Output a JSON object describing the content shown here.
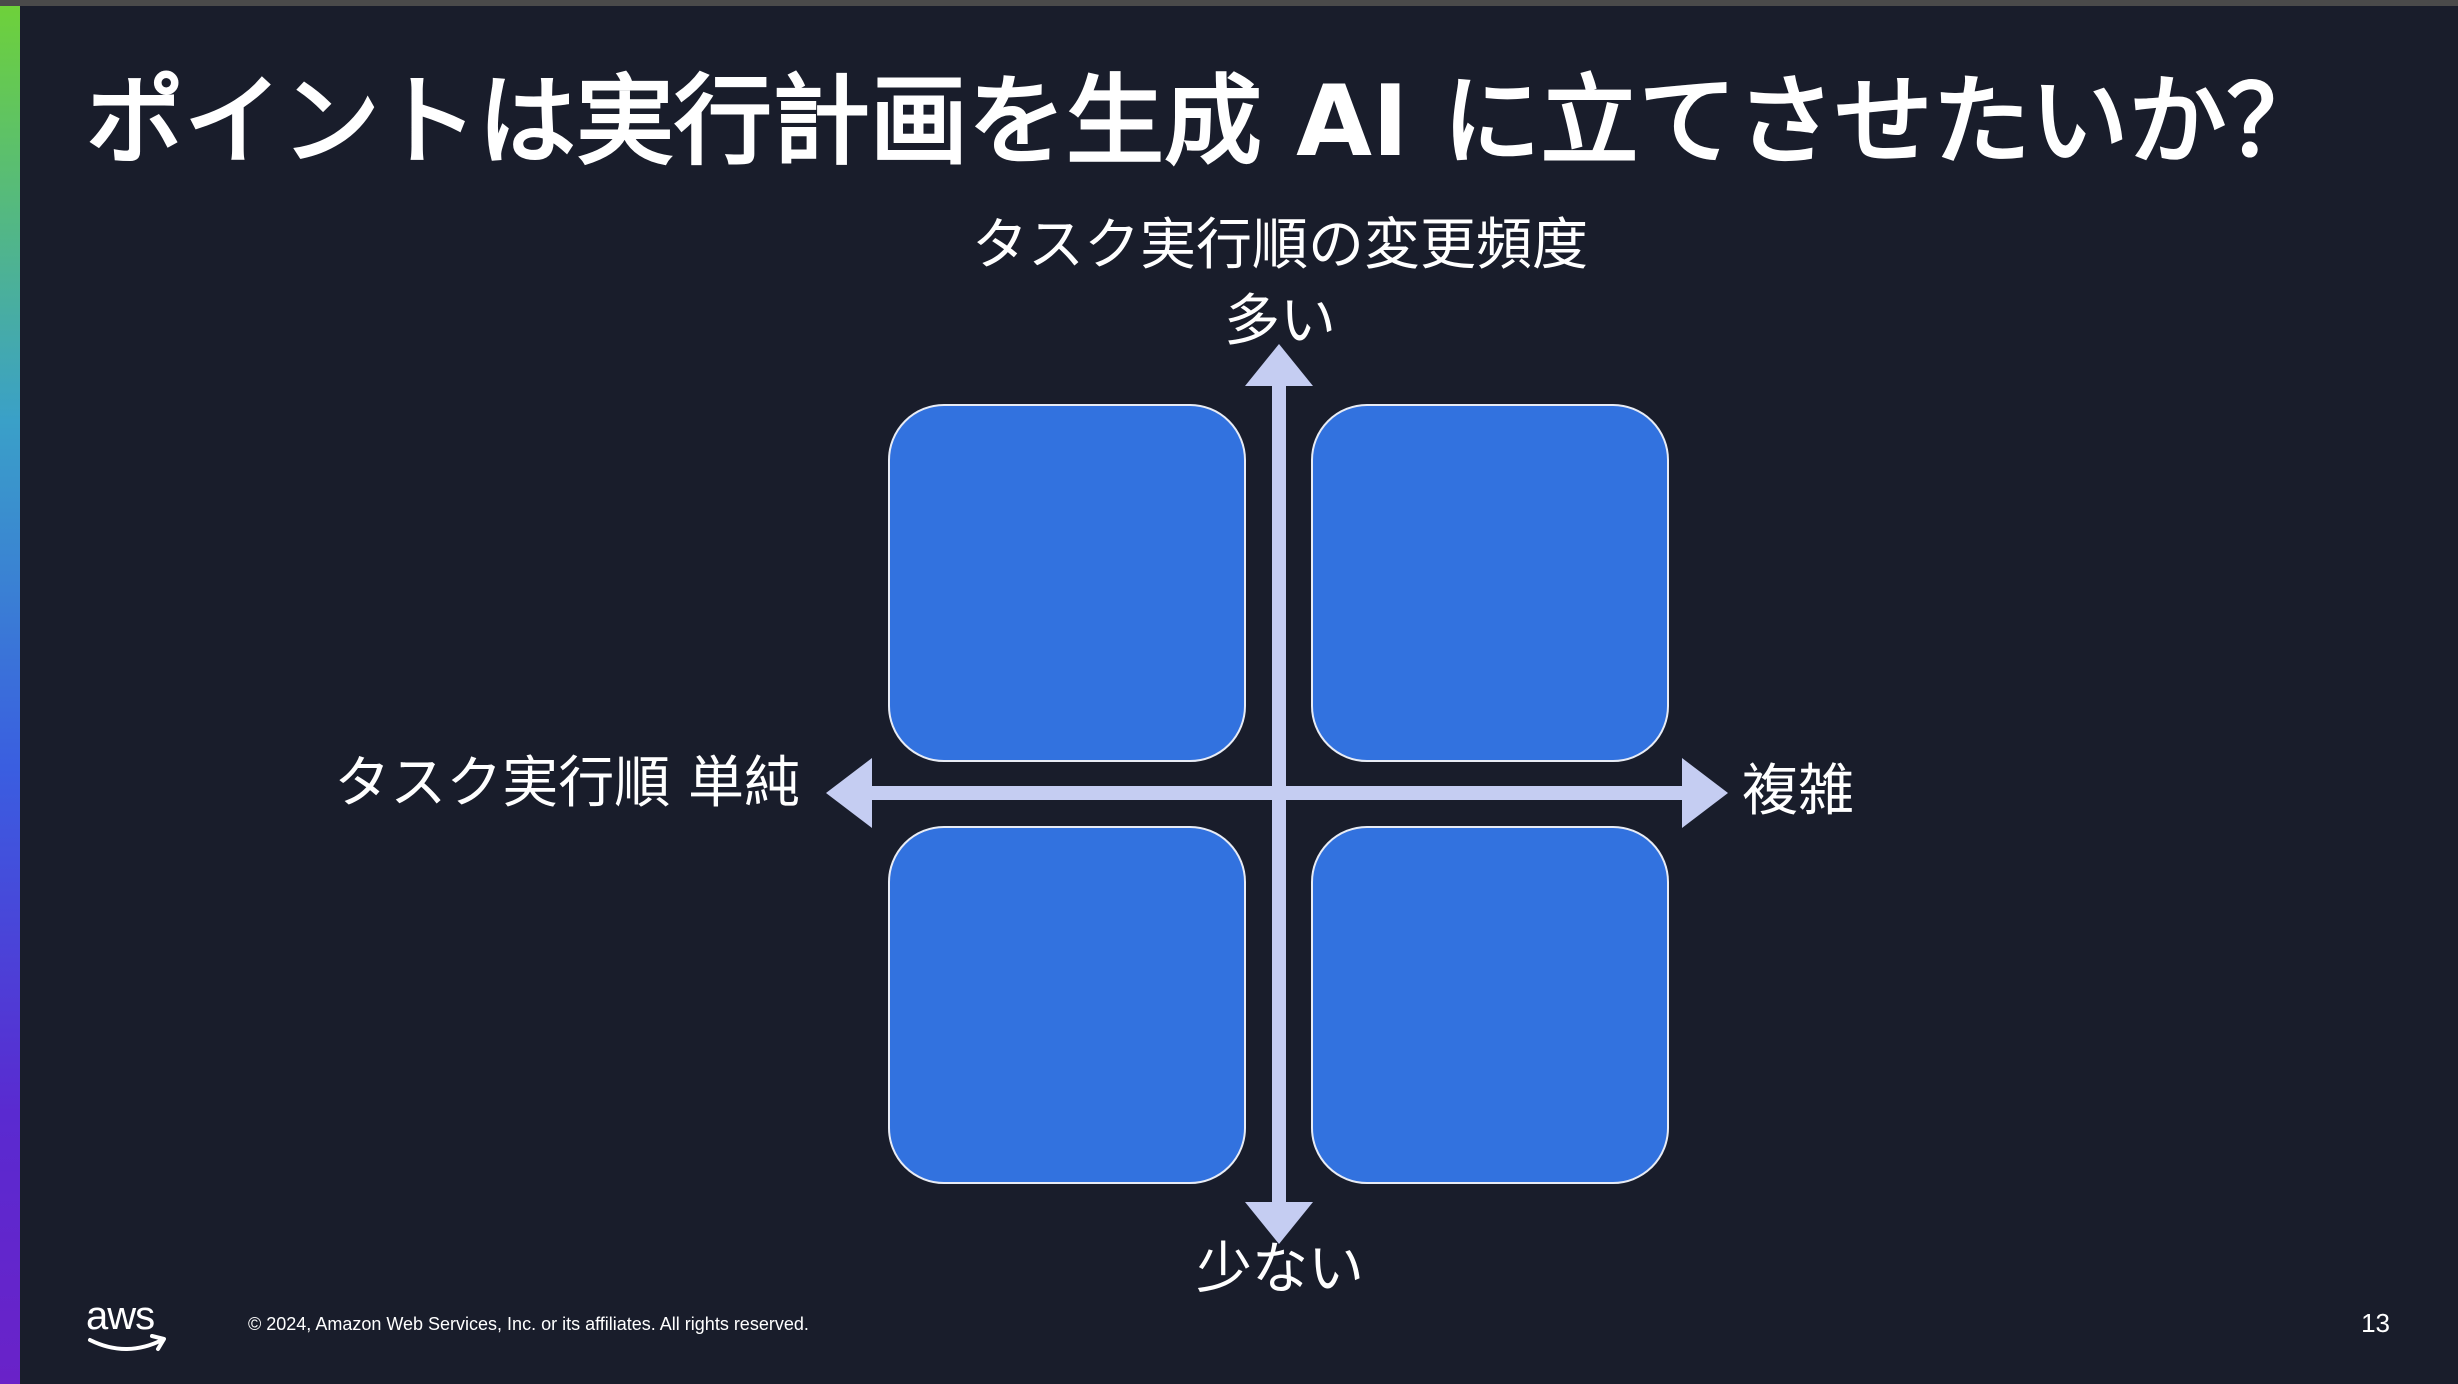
{
  "slide": {
    "title": "ポイントは実行計画を生成 AI に立てさせたいか？",
    "page_number": "13",
    "copyright": "© 2024, Amazon Web Services, Inc. or its affiliates. All rights reserved.",
    "logo_text": "aws"
  },
  "diagram": {
    "vertical_axis": {
      "title": "タスク実行順の変更頻度",
      "high_label": "多い",
      "low_label": "少ない"
    },
    "horizontal_axis": {
      "low_label": "タスク実行順 単純",
      "high_label": "複雑"
    },
    "quadrants": [
      {
        "position": "top-left",
        "label": ""
      },
      {
        "position": "top-right",
        "label": ""
      },
      {
        "position": "bottom-left",
        "label": ""
      },
      {
        "position": "bottom-right",
        "label": ""
      }
    ]
  },
  "colors": {
    "background": "#191d2b",
    "quadrant_fill": "#3272df",
    "quadrant_border": "#e8ecf5",
    "axis": "#c5cdf2",
    "text": "#ffffff",
    "accent_gradient": [
      "#6ed13a",
      "#3aa0c8",
      "#3a5ee0",
      "#6a22c8"
    ]
  }
}
